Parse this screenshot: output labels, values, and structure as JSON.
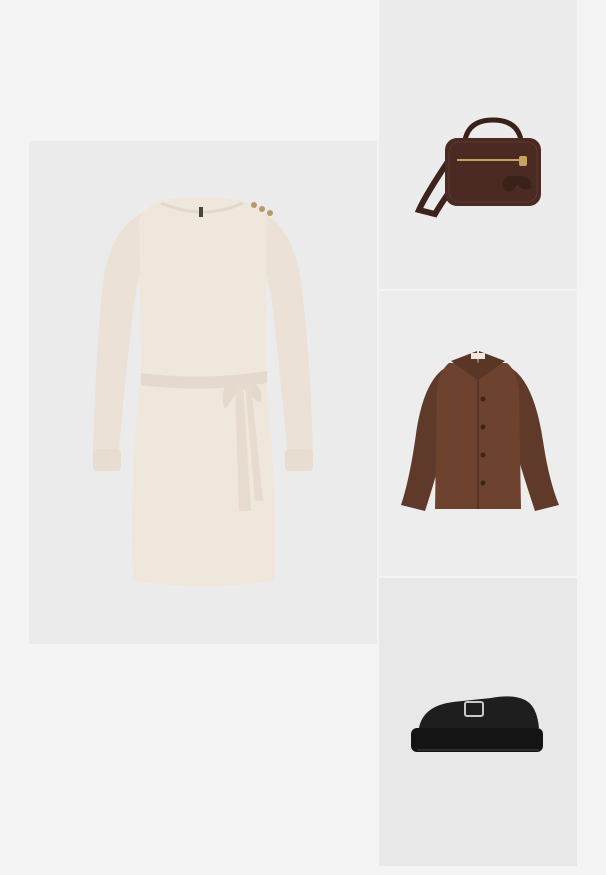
{
  "outfit": {
    "items": [
      {
        "id": "dress",
        "icon": "knit-dress-image"
      },
      {
        "id": "bag",
        "icon": "crossbody-bag-image"
      },
      {
        "id": "jacket",
        "icon": "brown-jacket-image"
      },
      {
        "id": "shoes",
        "icon": "chunky-loafer-image"
      }
    ],
    "colors": {
      "page_bg": "#f4f4f4",
      "tile_bg": "#ebebeb",
      "dress": "#efe6dc",
      "bag": "#4a2a22",
      "jacket": "#6d4330",
      "shoes": "#1c1c1c"
    }
  }
}
